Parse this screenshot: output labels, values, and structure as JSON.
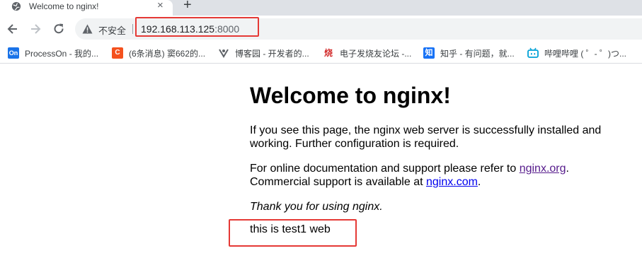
{
  "browser": {
    "tab": {
      "title": "Welcome to nginx!",
      "close_glyph": "×"
    },
    "new_tab_glyph": "+",
    "toolbar": {
      "security_label": "不安全",
      "url_host": "192.168.113.125",
      "url_port": ":8000"
    },
    "bookmarks": [
      {
        "label": "ProcessOn - 我的...",
        "icon_text": "On",
        "icon_color": "#1a73e8"
      },
      {
        "label": "(6条消息) 窦662的...",
        "icon_text": "C",
        "icon_color": "#f4511e"
      },
      {
        "label": "博客园 - 开发者的...",
        "icon_text": "",
        "icon_color": ""
      },
      {
        "label": "电子发烧友论坛 -...",
        "icon_text": "烧",
        "icon_color": ""
      },
      {
        "label": "知乎 - 有问题，就...",
        "icon_text": "知",
        "icon_color": "#1772f6"
      },
      {
        "label": "哔哩哔哩 ( ゜- ゜)つ...",
        "icon_text": "",
        "icon_color": "#00a1d6"
      }
    ]
  },
  "page": {
    "heading": "Welcome to nginx!",
    "para1": "If you see this page, the nginx web server is successfully installed and working. Further configuration is required.",
    "para2_prefix": "For online documentation and support please refer to ",
    "link_org": "nginx.org",
    "para2_mid": ".",
    "para2_line2_prefix": "Commercial support is available at ",
    "link_com": "nginx.com",
    "para2_suffix": ".",
    "thanks": "Thank you for using nginx.",
    "test_line": "this is test1 web"
  },
  "colors": {
    "annotation_red": "#e53935",
    "visited_link": "#551a8b",
    "link": "#0000ee"
  }
}
